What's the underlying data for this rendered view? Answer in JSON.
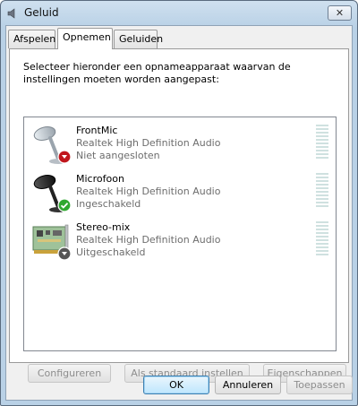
{
  "window": {
    "title": "Geluid"
  },
  "titlebar": {
    "close_glyph": "✕"
  },
  "tabs": [
    {
      "label": "Afspelen",
      "active": false
    },
    {
      "label": "Opnemen",
      "active": true
    },
    {
      "label": "Geluiden",
      "active": false
    }
  ],
  "panel": {
    "instruction": "Selecteer hieronder een opnameapparaat waarvan de instellingen moeten worden aangepast:"
  },
  "devices": [
    {
      "name": "FrontMic",
      "driver": "Realtek High Definition Audio",
      "status": "Niet aangesloten",
      "icon": "microphone-icon",
      "badge": "unplugged-badge",
      "badge_color": "#c0161c"
    },
    {
      "name": "Microfoon",
      "driver": "Realtek High Definition Audio",
      "status": "Ingeschakeld",
      "icon": "microphone-icon",
      "badge": "checkmark-badge",
      "badge_color": "#2fa82f"
    },
    {
      "name": "Stereo-mix",
      "driver": "Realtek High Definition Audio",
      "status": "Uitgeschakeld",
      "icon": "sound-card-icon",
      "badge": "disabled-badge",
      "badge_color": "#555555"
    }
  ],
  "buttons": {
    "configure": "Configureren",
    "set_default": "Als standaard instellen",
    "properties": "Eigenschappen",
    "ok": "OK",
    "cancel": "Annuleren",
    "apply": "Toepassen"
  }
}
